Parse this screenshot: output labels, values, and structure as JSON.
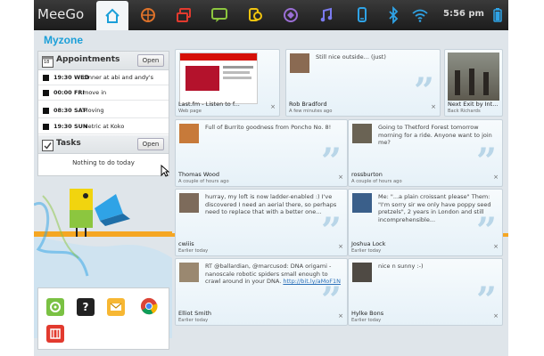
{
  "topbar": {
    "brand": "MeeGo",
    "clock": "5:56 pm",
    "icons": [
      "home-icon",
      "zones-icon",
      "apps-icon",
      "status-icon",
      "people-icon",
      "internet-icon",
      "music-icon",
      "devices-icon",
      "bluetooth-icon",
      "wifi-icon",
      "battery-icon"
    ]
  },
  "zone_title": "Myzone",
  "appointments": {
    "label": "Appointments",
    "calendar_day": "18",
    "open_label": "Open",
    "items": [
      {
        "when": "19:30 WED",
        "what": "dinner at abi and andy's"
      },
      {
        "when": "00:00 FRI",
        "what": "move in"
      },
      {
        "when": "08:30 SAT",
        "what": "Moving"
      },
      {
        "when": "19:30 SUN",
        "what": "Metric at Koko"
      }
    ]
  },
  "tasks": {
    "label": "Tasks",
    "open_label": "Open",
    "empty": "Nothing to do today"
  },
  "cards": {
    "c1": {
      "name": "Last.fm - Listen to f...",
      "time": "Web page"
    },
    "c2": {
      "msg": "Still nice outside... (just)",
      "name": "Rob Bradford",
      "time": "A few minutes ago"
    },
    "c3": {
      "name": "Next Exit by Int...",
      "time": "Back Richards"
    },
    "c4": {
      "msg": "Full of Burrito goodness from Poncho No. 8!",
      "name": "Thomas Wood",
      "time": "A couple of hours ago"
    },
    "c5": {
      "msg": "Going to Thetford Forest tomorrow morning for a ride. Anyone want to join me?",
      "name": "rossburton",
      "time": "A couple of hours ago"
    },
    "c6": {
      "msg": "hurray, my loft is now ladder-enabled :) I've discovered I need an aerial there, so perhaps need to replace that with a better one...",
      "name": "cwiiis",
      "time": "Earlier today"
    },
    "c7": {
      "msg": "Me: \"...a plain croissant please\" Them: \"I'm sorry sir we only have poppy seed pretzels\", 2 years in London and still incomprehensible...",
      "name": "Joshua Lock",
      "time": "Earlier today"
    },
    "c8": {
      "msg": "RT @ballardian, @marcusod: DNA origami - nanoscale robotic spiders small enough to crawl around in your DNA.",
      "link": "http://bit.ly/aMoF1N",
      "name": "Elliot Smith",
      "time": "Earlier today"
    },
    "c9": {
      "msg": "nice n sunny :-)",
      "name": "Hylke Bons",
      "time": "Earlier today"
    }
  },
  "close_glyph": "×",
  "quote_glyph": "”",
  "colors": {
    "accent": "#1b9fd8",
    "topbar": "#262626",
    "card_bg": "#eef6fb",
    "stripe": "#f5a623"
  }
}
